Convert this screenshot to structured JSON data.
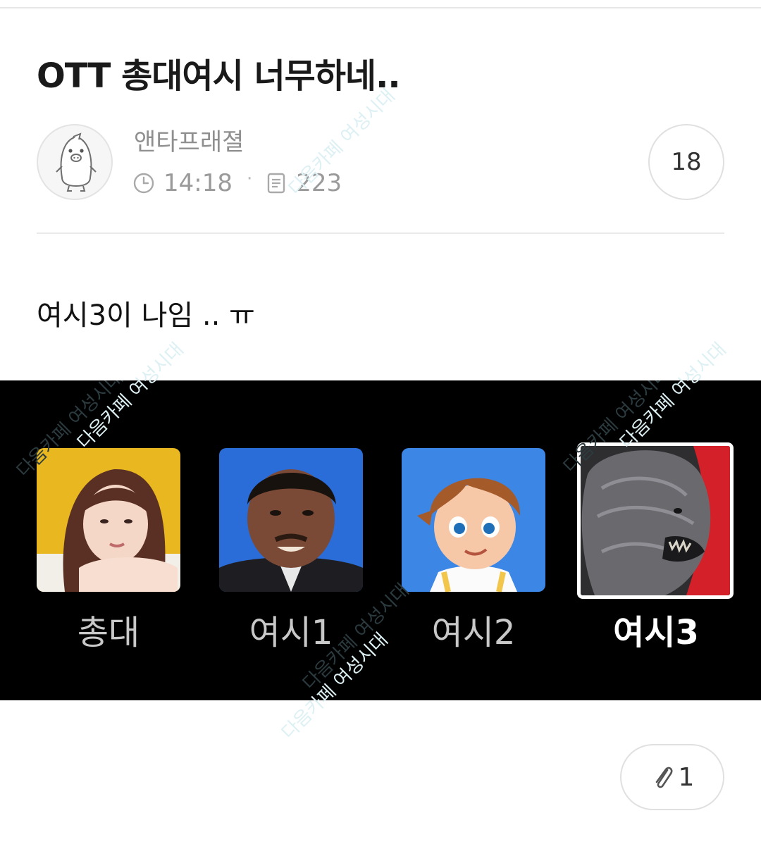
{
  "post": {
    "title": "OTT 총대여시 너무하네..",
    "author": "앤타프래졀",
    "time": "14:18",
    "views": "223",
    "comment_count": "18",
    "body_text": "여시3이 나임 .. ㅠ",
    "attachment_count": "1"
  },
  "image": {
    "profiles": [
      {
        "label": "총대",
        "icon": "woman-portrait",
        "selected": false
      },
      {
        "label": "여시1",
        "icon": "man-portrait",
        "selected": false
      },
      {
        "label": "여시2",
        "icon": "cartoon-boy",
        "selected": false
      },
      {
        "label": "여시3",
        "icon": "monster-portrait",
        "selected": true
      }
    ]
  },
  "watermark": "다음카페 여성시대",
  "icons": {
    "time": "clock-icon",
    "views": "document-icon",
    "attachment": "paperclip-icon",
    "avatar": "penguin-avatar"
  },
  "colors": {
    "meta_gray": "#9a9a9a",
    "image_background": "#000000",
    "selected_label": "#ffffff",
    "unselected_label": "#c8c8c8"
  }
}
